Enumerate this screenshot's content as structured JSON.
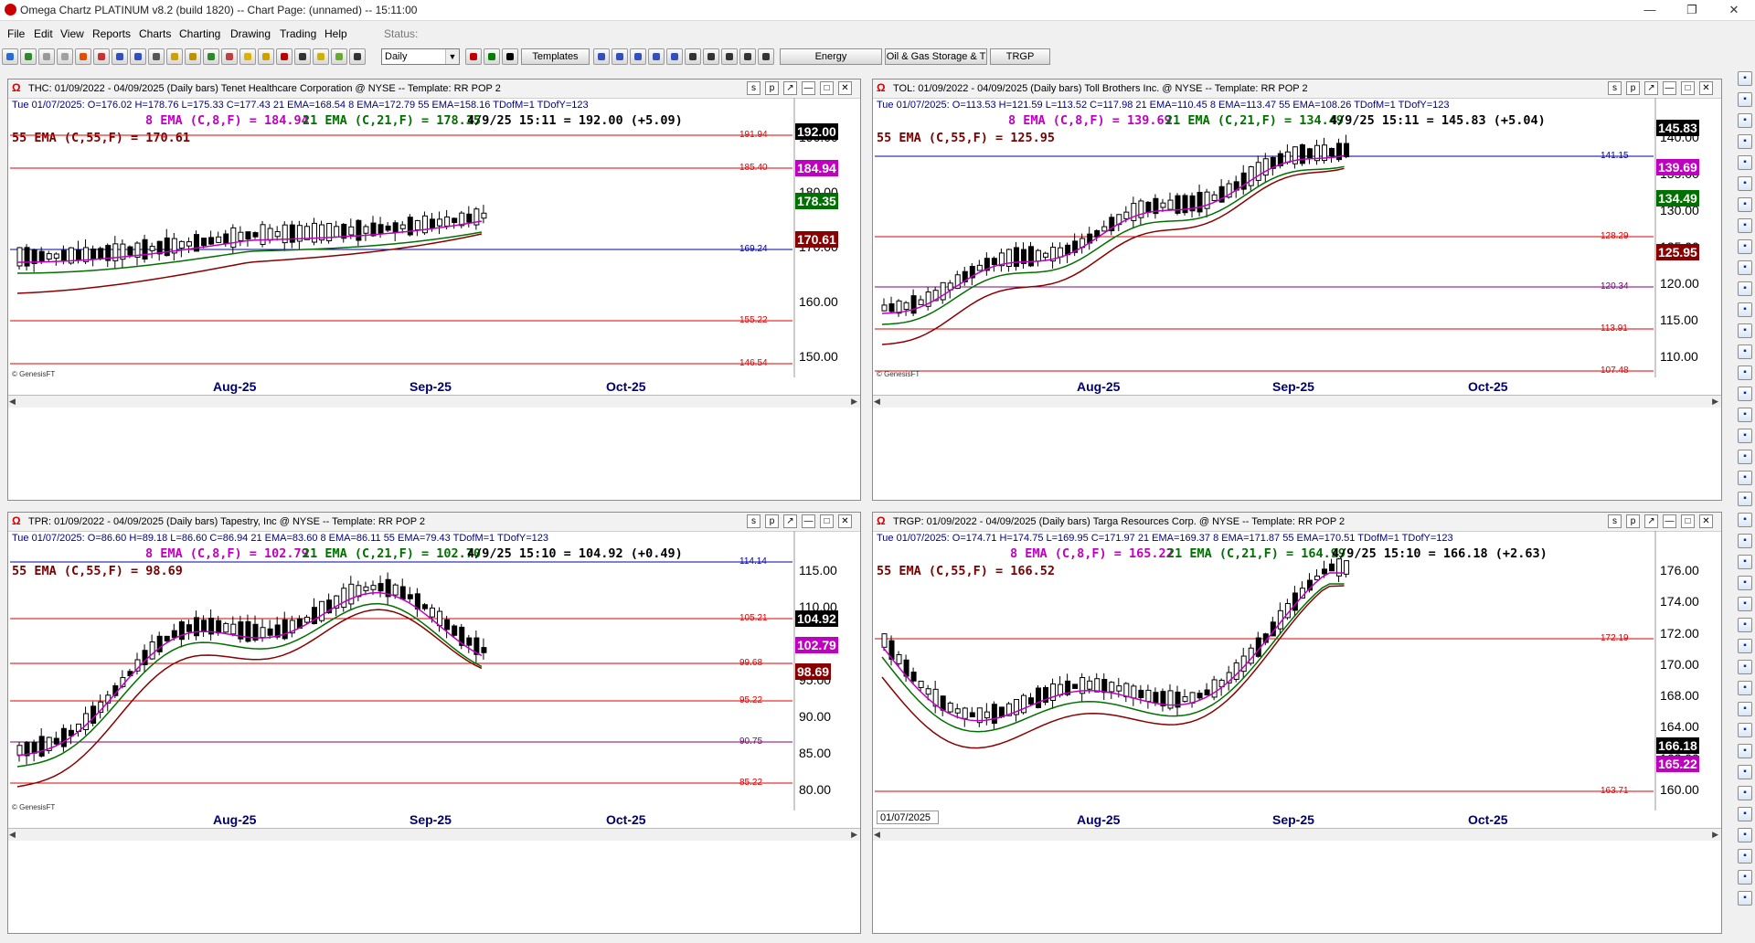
{
  "window": {
    "title": "Omega Chartz PLATINUM v8.2 (build 1820)  --  Chart Page: (unnamed)  --  15:11:00",
    "colors": {
      "accent": "#0000ff",
      "red_line": "#e00000",
      "blue_line": "#0000a0"
    }
  },
  "menu": {
    "items": [
      "File",
      "Edit",
      "View",
      "Reports",
      "Charts",
      "Charting",
      "Drawing",
      "Trading",
      "Help"
    ],
    "status_label": "Status:"
  },
  "toolbar": {
    "period_value": "Daily",
    "templates_label": "Templates",
    "tabs": [
      "Energy",
      "Oil & Gas Storage & T",
      "TRGP"
    ]
  },
  "panels": [
    {
      "id": "thc",
      "title": "THC: 01/09/2022 - 04/09/2025  (Daily bars)   Tenet Healthcare Corporation @ NYSE  --  Template: RR POP 2",
      "info": "Tue  01/07/2025:  O=176.02  H=178.76  L=175.33  C=177.43  21 EMA=168.54  8 EMA=172.79  55 EMA=158.16  TDofM=1  TDofY=123",
      "ema8": "8 EMA (C,8,F) = 184.94",
      "ema21": "21 EMA (C,21,F) = 178.35",
      "last": "4/9/25 15:11 = 192.00 (+5.09)",
      "ema55": "55 EMA (C,55,F) = 170.61",
      "yaxis": [
        "190.00",
        "180.00",
        "170.00",
        "160.00",
        "150.00"
      ],
      "xlabels": [
        "Aug-25",
        "Sep-25",
        "Oct-25"
      ],
      "hlines": [
        {
          "label": "191.94",
          "color": "#e00000"
        },
        {
          "label": "185.40",
          "color": "#e00000"
        },
        {
          "label": "169.24",
          "color": "#0000a0"
        },
        {
          "label": "155.22",
          "color": "#e00000"
        },
        {
          "label": "146.54",
          "color": "#e00000"
        }
      ],
      "boxes": [
        {
          "text": "192.00",
          "color": "#000000"
        },
        {
          "text": "184.94",
          "color": "#c000c0"
        },
        {
          "text": "178.35",
          "color": "#007000"
        },
        {
          "text": "170.61",
          "color": "#8a0000"
        }
      ],
      "footer": "© GenesisFT"
    },
    {
      "id": "tol",
      "title": "TOL: 01/09/2022 - 04/09/2025  (Daily bars)   Toll Brothers Inc. @ NYSE  --  Template: RR POP 2",
      "info": "Tue  01/07/2025:  O=113.53  H=121.59  L=113.52  C=117.98  21 EMA=110.45  8 EMA=113.47  55 EMA=108.26  TDofM=1  TDofY=123",
      "ema8": "8 EMA (C,8,F) = 139.69",
      "ema21": "21 EMA (C,21,F) = 134.49",
      "last": "4/9/25 15:11 = 145.83 (+5.04)",
      "ema55": "55 EMA (C,55,F) = 125.95",
      "yaxis": [
        "140.00",
        "135.00",
        "130.00",
        "125.00",
        "120.00",
        "115.00",
        "110.00"
      ],
      "xlabels": [
        "Aug-25",
        "Sep-25",
        "Oct-25"
      ],
      "hlines": [
        {
          "label": "141.15",
          "color": "#0000a0"
        },
        {
          "label": "128.29",
          "color": "#e00000"
        },
        {
          "label": "120.34",
          "color": "#800080"
        },
        {
          "label": "113.91",
          "color": "#e00000"
        },
        {
          "label": "107.48",
          "color": "#e00000"
        }
      ],
      "boxes": [
        {
          "text": "145.83",
          "color": "#000000"
        },
        {
          "text": "139.69",
          "color": "#c000c0"
        },
        {
          "text": "134.49",
          "color": "#007000"
        },
        {
          "text": "125.95",
          "color": "#8a0000"
        }
      ],
      "footer": "© GenesisFT"
    },
    {
      "id": "tpr",
      "title": "TPR: 01/09/2022 - 04/09/2025  (Daily bars)   Tapestry, Inc @ NYSE  --  Template: RR POP 2",
      "info": "Tue  01/07/2025:  O=86.60  H=89.18  L=86.60  C=86.94  21 EMA=83.60  8 EMA=86.11  55 EMA=79.43  TDofM=1  TDofY=123",
      "ema8": "8 EMA (C,8,F) = 102.79",
      "ema21": "21 EMA (C,21,F) = 102.70",
      "last": "4/9/25 15:10 = 104.92 (+0.49)",
      "ema55": "55 EMA (C,55,F) = 98.69",
      "yaxis": [
        "115.00",
        "110.00",
        "100.00",
        "95.00",
        "90.00",
        "85.00",
        "80.00"
      ],
      "xlabels": [
        "Aug-25",
        "Sep-25",
        "Oct-25"
      ],
      "hlines": [
        {
          "label": "114.14",
          "color": "#0000a0"
        },
        {
          "label": "105.21",
          "color": "#e00000"
        },
        {
          "label": "99.68",
          "color": "#e00000"
        },
        {
          "label": "95.22",
          "color": "#e00000"
        },
        {
          "label": "90.75",
          "color": "#800080"
        },
        {
          "label": "85.22",
          "color": "#e00000"
        }
      ],
      "boxes": [
        {
          "text": "104.92",
          "color": "#000000"
        },
        {
          "text": "102.79",
          "color": "#c000c0"
        },
        {
          "text": "98.69",
          "color": "#8a0000"
        }
      ],
      "footer": "© GenesisFT"
    },
    {
      "id": "trgp",
      "title": "TRGP: 01/09/2022 - 04/09/2025  (Daily bars)   Targa Resources Corp. @ NYSE  --  Template: RR POP 2",
      "info": "Tue  01/07/2025:  O=174.71  H=174.75  L=169.95  C=171.97  21 EMA=169.37  8 EMA=171.87  55 EMA=170.51  TDofM=1  TDofY=123",
      "ema8": "8 EMA (C,8,F) = 165.22",
      "ema21": "21 EMA (C,21,F) = 164.99",
      "last": "4/9/25 15:10 = 166.18 (+2.63)",
      "ema55": "55 EMA (C,55,F) = 166.52",
      "yaxis": [
        "176.00",
        "174.00",
        "172.00",
        "170.00",
        "168.00",
        "164.00",
        "162.00",
        "160.00"
      ],
      "xlabels": [
        "Aug-25",
        "Sep-25",
        "Oct-25"
      ],
      "hlines": [
        {
          "label": "172.19",
          "color": "#e00000"
        },
        {
          "label": "163.71",
          "color": "#e00000"
        }
      ],
      "boxes": [
        {
          "text": "166.18",
          "color": "#000000"
        },
        {
          "text": "165.22",
          "color": "#c000c0"
        }
      ],
      "footer": "",
      "date_box": "01/07/2025"
    }
  ]
}
